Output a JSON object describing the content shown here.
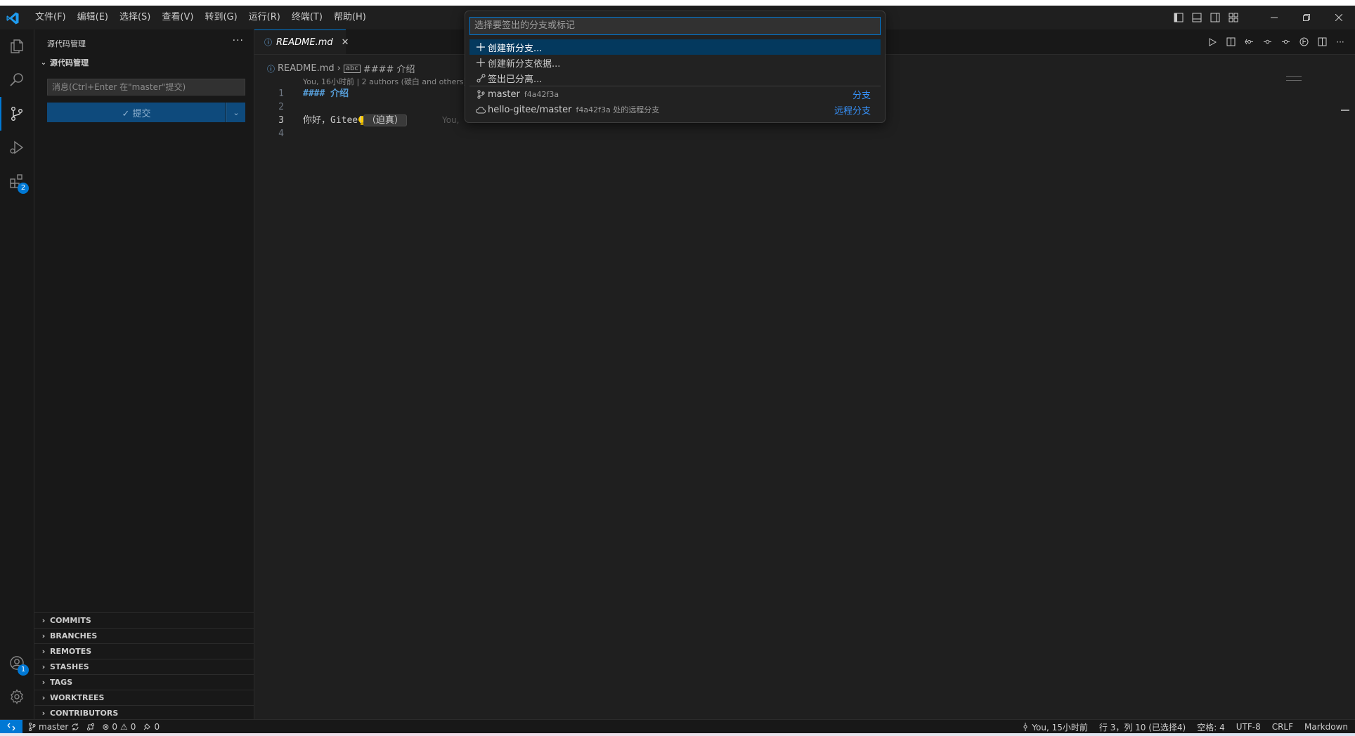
{
  "menu": [
    "文件(F)",
    "编辑(E)",
    "选择(S)",
    "查看(V)",
    "转到(G)",
    "运行(R)",
    "终端(T)",
    "帮助(H)"
  ],
  "activity": {
    "extensions_badge": "2",
    "accounts_badge": "1"
  },
  "sidebar": {
    "title": "源代码管理",
    "more": "···",
    "section": "源代码管理",
    "message_placeholder": "消息(Ctrl+Enter 在\"master\"提交)",
    "commit_label": "✓ 提交",
    "panels": [
      "COMMITS",
      "BRANCHES",
      "REMOTES",
      "STASHES",
      "TAGS",
      "WORKTREES",
      "CONTRIBUTORS"
    ]
  },
  "editor": {
    "tab_name": "README.md",
    "breadcrumb_file": "README.md",
    "breadcrumb_symbol": "#### 介绍",
    "blame_header": "You, 16小时前 | 2 authors (碳白 and others)",
    "lines": [
      {
        "num": "1",
        "text": "#### 介绍"
      },
      {
        "num": "2",
        "text": ""
      },
      {
        "num": "3",
        "text": "你好，Gitee!"
      },
      {
        "num": "4",
        "text": ""
      }
    ],
    "line3_pill": "（迫真）",
    "ghost_blame": "You,"
  },
  "quickpick": {
    "placeholder": "选择要签出的分支或标记",
    "items": [
      {
        "icon": "plus-icon",
        "label": "创建新分支...",
        "desc": "",
        "detail": ""
      },
      {
        "icon": "plus-icon",
        "label": "创建新分支依据...",
        "desc": "",
        "detail": ""
      },
      {
        "icon": "detach-icon",
        "label": "签出已分离...",
        "desc": "",
        "detail": ""
      },
      {
        "icon": "branch-icon",
        "label": "master",
        "desc": "f4a42f3a",
        "detail": "分支"
      },
      {
        "icon": "cloud-icon",
        "label": "hello-gitee/master",
        "desc": "f4a42f3a 处的远程分支",
        "detail": "远程分支"
      }
    ]
  },
  "status": {
    "branch": "master",
    "errors": "0",
    "warnings": "0",
    "ports": "0",
    "blame": "You, 15小时前",
    "position": "行 3，列 10 (已选择4)",
    "indent": "空格: 4",
    "encoding": "UTF-8",
    "eol": "CRLF",
    "language": "Markdown"
  },
  "colors": {
    "accent": "#0078d4",
    "editor_bg": "#1f1f1f",
    "sidebar_bg": "#181818",
    "link": "#3794ff"
  }
}
